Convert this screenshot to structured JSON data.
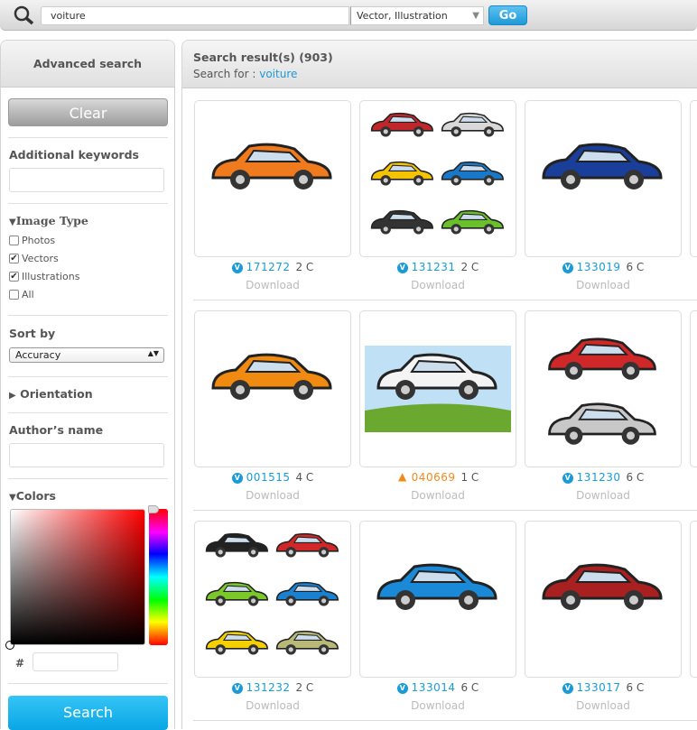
{
  "topbar": {
    "query": "voiture",
    "type": "Vector, Illustration",
    "go": "Go",
    "search_icon": "magnifier-icon"
  },
  "sidebar": {
    "title": "Advanced search",
    "clear": "Clear",
    "keywords_label": "Additional keywords",
    "image_type": "Image Type",
    "types": [
      {
        "label": "Photos",
        "checked": false
      },
      {
        "label": "Vectors",
        "checked": true
      },
      {
        "label": "Illustrations",
        "checked": true
      },
      {
        "label": "All",
        "checked": false
      }
    ],
    "sort_label": "Sort by",
    "sort_value": "Accuracy",
    "orientation": "Orientation",
    "author_label": "Author’s name",
    "colors": "Colors",
    "hash": "#",
    "search": "Search"
  },
  "results": {
    "title": "Search result(s) (903)",
    "search_for": "Search for :",
    "term": "voiture",
    "download": "Download",
    "items": [
      {
        "id": "171272",
        "colors": "2 C",
        "status": "vector",
        "car": [
          "#f07a1e"
        ]
      },
      {
        "id": "131231",
        "colors": "2 C",
        "status": "vector",
        "car": [
          "#c0262a",
          "#d8d8d8",
          "#f5c400",
          "#1a78c8",
          "#333333",
          "#6ac02a"
        ]
      },
      {
        "id": "133019",
        "colors": "6 C",
        "status": "vector",
        "car": [
          "#1a3f9a"
        ]
      },
      {
        "id": "001515",
        "colors": "4 C",
        "status": "vector",
        "car": [
          "#f08a10"
        ]
      },
      {
        "id": "040669",
        "colors": "1 C",
        "status": "warning",
        "car": [
          "#f4f4f4"
        ]
      },
      {
        "id": "131230",
        "colors": "6 C",
        "status": "vector",
        "car": [
          "#d02828",
          "#c8c8c8"
        ]
      },
      {
        "id": "131232",
        "colors": "2 C",
        "status": "vector",
        "car": [
          "#222222",
          "#d02828",
          "#7ac82a",
          "#1a80d0",
          "#f5d000",
          "#b8b878"
        ]
      },
      {
        "id": "133014",
        "colors": "6 C",
        "status": "vector",
        "car": [
          "#1a8ad8"
        ]
      },
      {
        "id": "133017",
        "colors": "6 C",
        "status": "vector",
        "car": [
          "#a82020"
        ]
      }
    ]
  },
  "colors": {
    "accent": "#1a9ad6",
    "warning": "#f08a1c"
  }
}
